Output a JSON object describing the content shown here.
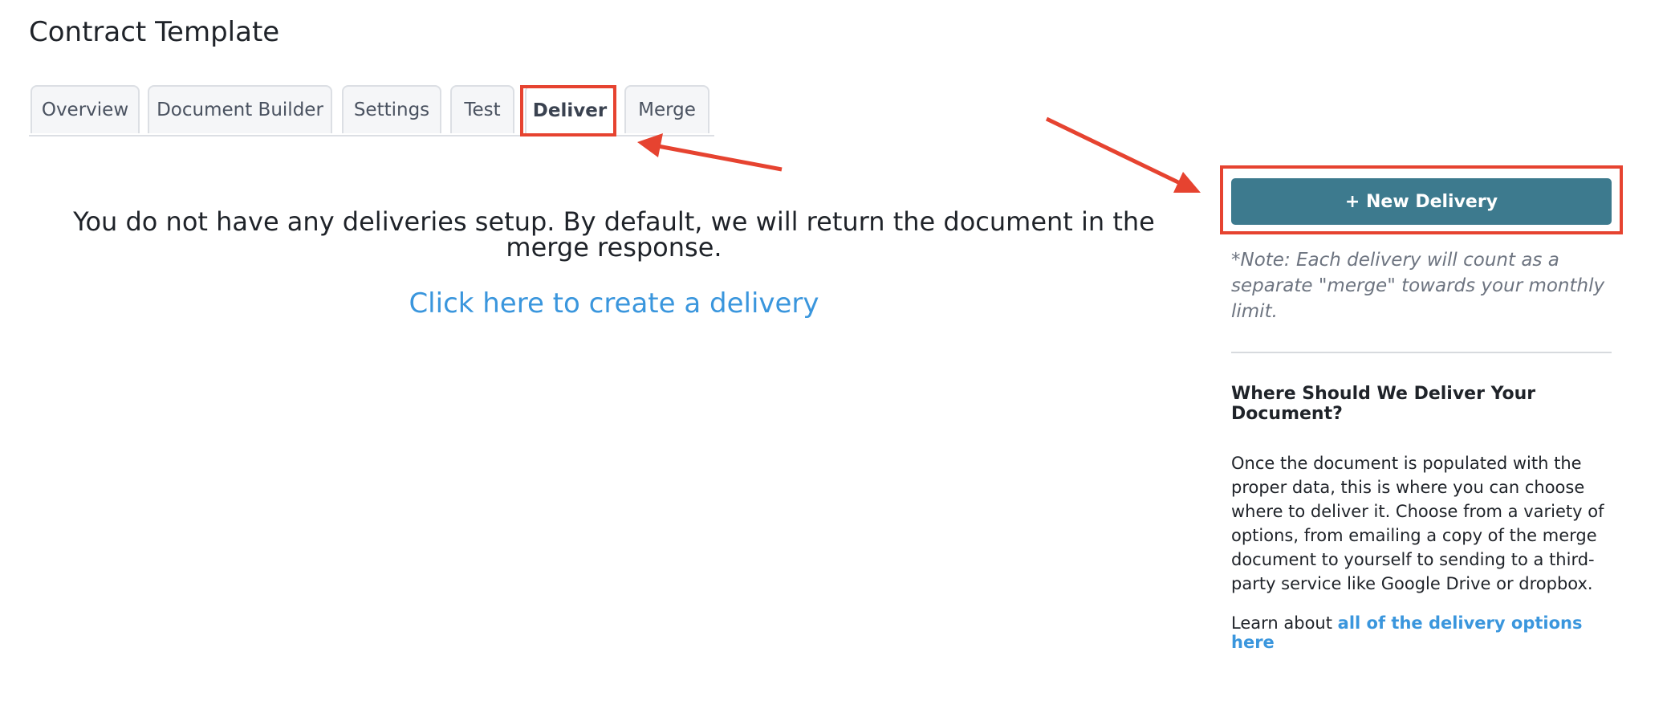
{
  "page": {
    "title": "Contract Template"
  },
  "tabs": [
    {
      "label": "Overview"
    },
    {
      "label": "Document Builder"
    },
    {
      "label": "Settings"
    },
    {
      "label": "Test"
    },
    {
      "label": "Deliver"
    },
    {
      "label": "Merge"
    }
  ],
  "active_tab": "Deliver",
  "main": {
    "empty_message": "You do not have any deliveries setup. By default, we will return the document in the merge response.",
    "create_link": "Click here to create a delivery"
  },
  "sidebar": {
    "new_delivery_label": "+ New Delivery",
    "note": "*Note: Each delivery will count as a separate \"merge\" towards your monthly limit.",
    "heading": "Where Should We Deliver Your Document?",
    "body": "Once the document is populated with the proper data, this is where you can choose where to deliver it. Choose from a variety of options, from emailing a copy of the merge document to yourself to sending to a third-party service like Google Drive or dropbox.",
    "learn_prefix": "Learn about",
    "learn_link": "all of the delivery options here"
  },
  "colors": {
    "annotation": "#e64330",
    "button": "#3d7a8e",
    "link": "#3a96dd"
  }
}
